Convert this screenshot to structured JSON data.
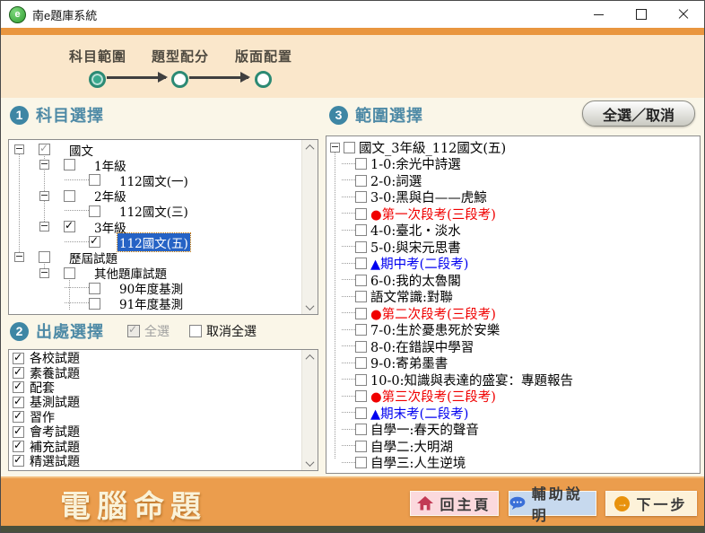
{
  "window": {
    "title": "南e題庫系統"
  },
  "stepper": {
    "steps": [
      {
        "label": "科目範圍",
        "active": true
      },
      {
        "label": "題型配分",
        "active": false
      },
      {
        "label": "版面配置",
        "active": false
      }
    ]
  },
  "subject_panel": {
    "number": "1",
    "title": "科目選擇",
    "tree": [
      {
        "label": "國文",
        "level": 0,
        "expander": true,
        "checked": "partial"
      },
      {
        "label": "1年級",
        "level": 1,
        "expander": true,
        "checked": false
      },
      {
        "label": "112國文(一)",
        "level": 2,
        "expander": false,
        "checked": false
      },
      {
        "label": "2年級",
        "level": 1,
        "expander": true,
        "checked": false
      },
      {
        "label": "112國文(三)",
        "level": 2,
        "expander": false,
        "checked": false
      },
      {
        "label": "3年級",
        "level": 1,
        "expander": true,
        "checked": true
      },
      {
        "label": "112國文(五)",
        "level": 2,
        "expander": false,
        "checked": true,
        "selected": true
      },
      {
        "label": "歷屆試題",
        "level": 0,
        "expander": true,
        "checked": false
      },
      {
        "label": "其他題庫試題",
        "level": 1,
        "expander": true,
        "checked": false
      },
      {
        "label": "90年度基測",
        "level": 2,
        "expander": false,
        "checked": false
      },
      {
        "label": "91年度基測",
        "level": 2,
        "expander": false,
        "checked": false
      }
    ]
  },
  "source_panel": {
    "number": "2",
    "title": "出處選擇",
    "select_all_label": "全選",
    "deselect_all_label": "取消全選",
    "items": [
      {
        "label": "各校試題",
        "checked": true
      },
      {
        "label": "素養試題",
        "checked": true
      },
      {
        "label": "配套",
        "checked": true
      },
      {
        "label": "基測試題",
        "checked": true
      },
      {
        "label": "習作",
        "checked": true
      },
      {
        "label": "會考試題",
        "checked": true
      },
      {
        "label": "補充試題",
        "checked": true
      },
      {
        "label": "精選試題",
        "checked": true
      }
    ]
  },
  "range_panel": {
    "number": "3",
    "title": "範圍選擇",
    "toggle_button_label": "全選／取消",
    "tree": [
      {
        "label": "國文_3年級_112國文(五)",
        "level": 0,
        "expander": true,
        "checked": false
      },
      {
        "label": "1-0:余光中詩選",
        "level": 1,
        "checked": false
      },
      {
        "label": "2-0:詞選",
        "level": 1,
        "checked": false
      },
      {
        "label": "3-0:黑與白——虎鯨",
        "level": 1,
        "checked": false
      },
      {
        "label": "●第一次段考(三段考)",
        "level": 1,
        "checked": false,
        "color": "red"
      },
      {
        "label": "4-0:臺北・淡水",
        "level": 1,
        "checked": false
      },
      {
        "label": "5-0:與宋元思書",
        "level": 1,
        "checked": false
      },
      {
        "label": "▲期中考(二段考)",
        "level": 1,
        "checked": false,
        "color": "blue"
      },
      {
        "label": "6-0:我的太魯閣",
        "level": 1,
        "checked": false
      },
      {
        "label": "語文常識:對聯",
        "level": 1,
        "checked": false
      },
      {
        "label": "●第二次段考(三段考)",
        "level": 1,
        "checked": false,
        "color": "red"
      },
      {
        "label": "7-0:生於憂患死於安樂",
        "level": 1,
        "checked": false
      },
      {
        "label": "8-0:在錯誤中學習",
        "level": 1,
        "checked": false
      },
      {
        "label": "9-0:寄弟墨書",
        "level": 1,
        "checked": false
      },
      {
        "label": "10-0:知識與表達的盛宴：專題報告",
        "level": 1,
        "checked": false
      },
      {
        "label": "●第三次段考(三段考)",
        "level": 1,
        "checked": false,
        "color": "red"
      },
      {
        "label": "▲期末考(二段考)",
        "level": 1,
        "checked": false,
        "color": "blue"
      },
      {
        "label": "自學一:春天的聲音",
        "level": 1,
        "checked": false
      },
      {
        "label": "自學二:大明湖",
        "level": 1,
        "checked": false
      },
      {
        "label": "自學三:人生逆境",
        "level": 1,
        "checked": false
      }
    ]
  },
  "footer": {
    "brand": "電腦命題",
    "home_button": "回主頁",
    "help_button": "輔助說明",
    "next_button": "下一步"
  },
  "colors": {
    "accent_orange": "#eb9d4d",
    "band_peach": "#fae7cb",
    "header_blue": "#4e8aa6",
    "selection_blue": "#2663c5",
    "item_red": "#f00000",
    "item_blue": "#0000f0",
    "step_teal": "#3aa98e"
  }
}
